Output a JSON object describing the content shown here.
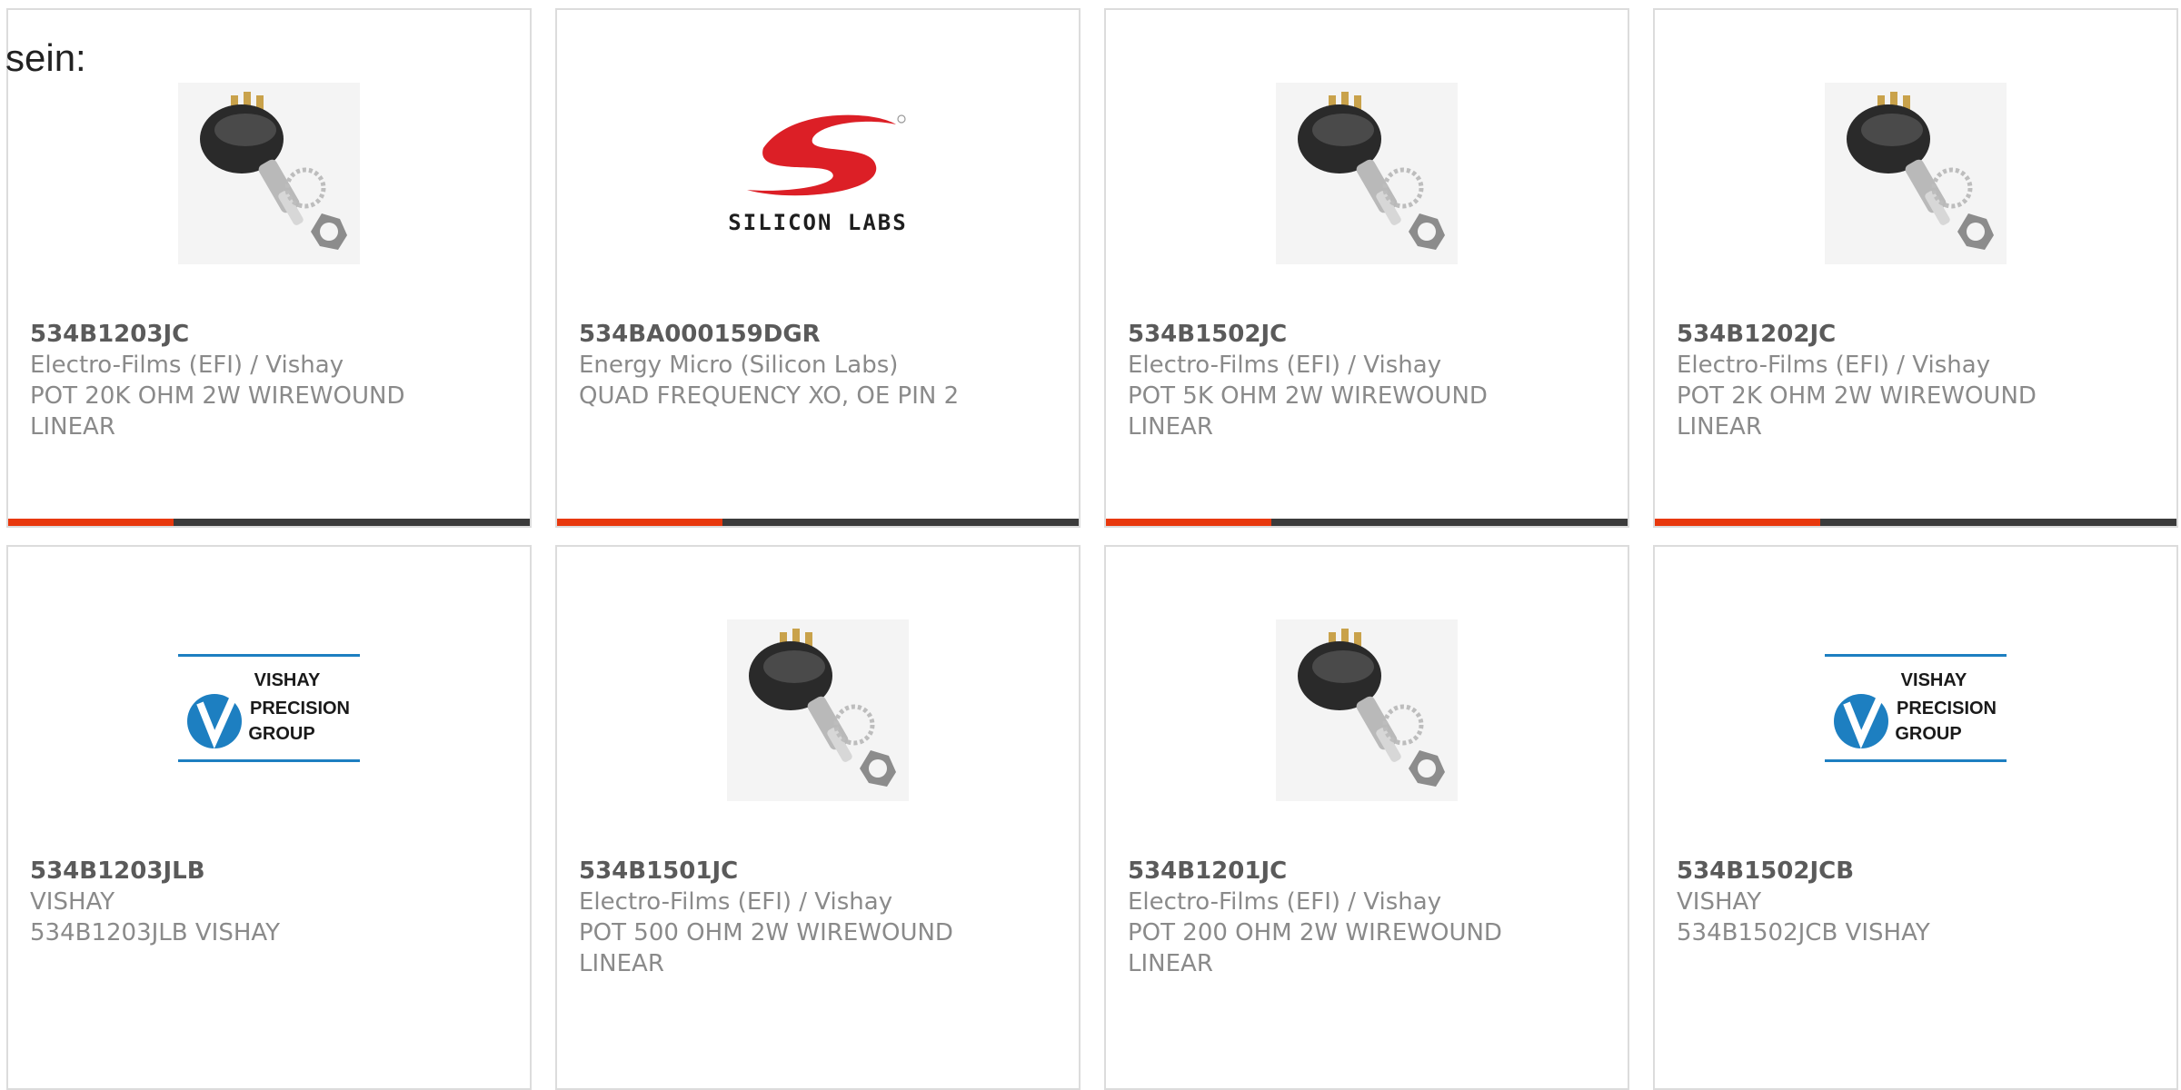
{
  "intro_text": "sein:",
  "colors": {
    "accent": "#e8380d",
    "bar": "#3b3b3b",
    "part_number": "#5a5a5a",
    "description": "#8a8a8a",
    "card_border": "#dcdcdc"
  },
  "products": [
    {
      "part_number": "534B1203JC",
      "manufacturer": "Electro-Films (EFI) / Vishay",
      "description_line1": "POT 20K OHM 2W WIREWOUND",
      "description_line2": "LINEAR",
      "image": "potentiometer-image"
    },
    {
      "part_number": "534BA000159DGR",
      "manufacturer": "Energy Micro (Silicon Labs)",
      "description_line1": "QUAD FREQUENCY XO, OE PIN 2",
      "description_line2": "",
      "image": "silicon-labs-logo",
      "logo_text": "SILICON LABS"
    },
    {
      "part_number": "534B1502JC",
      "manufacturer": "Electro-Films (EFI) / Vishay",
      "description_line1": "POT 5K OHM 2W WIREWOUND",
      "description_line2": "LINEAR",
      "image": "potentiometer-image"
    },
    {
      "part_number": "534B1202JC",
      "manufacturer": "Electro-Films (EFI) / Vishay",
      "description_line1": "POT 2K OHM 2W WIREWOUND",
      "description_line2": "LINEAR",
      "image": "potentiometer-image"
    },
    {
      "part_number": "534B1203JLB",
      "manufacturer": "VISHAY",
      "description_line1": "534B1203JLB VISHAY",
      "description_line2": "",
      "image": "vishay-precision-group-logo",
      "logo_lines": [
        "VISHAY",
        "PRECISION",
        "GROUP"
      ]
    },
    {
      "part_number": "534B1501JC",
      "manufacturer": "Electro-Films (EFI) / Vishay",
      "description_line1": "POT 500 OHM 2W WIREWOUND",
      "description_line2": "LINEAR",
      "image": "potentiometer-image"
    },
    {
      "part_number": "534B1201JC",
      "manufacturer": "Electro-Films (EFI) / Vishay",
      "description_line1": "POT 200 OHM 2W WIREWOUND",
      "description_line2": "LINEAR",
      "image": "potentiometer-image"
    },
    {
      "part_number": "534B1502JCB",
      "manufacturer": "VISHAY",
      "description_line1": "534B1502JCB VISHAY",
      "description_line2": "",
      "image": "vishay-precision-group-logo",
      "logo_lines": [
        "VISHAY",
        "PRECISION",
        "GROUP"
      ]
    }
  ]
}
